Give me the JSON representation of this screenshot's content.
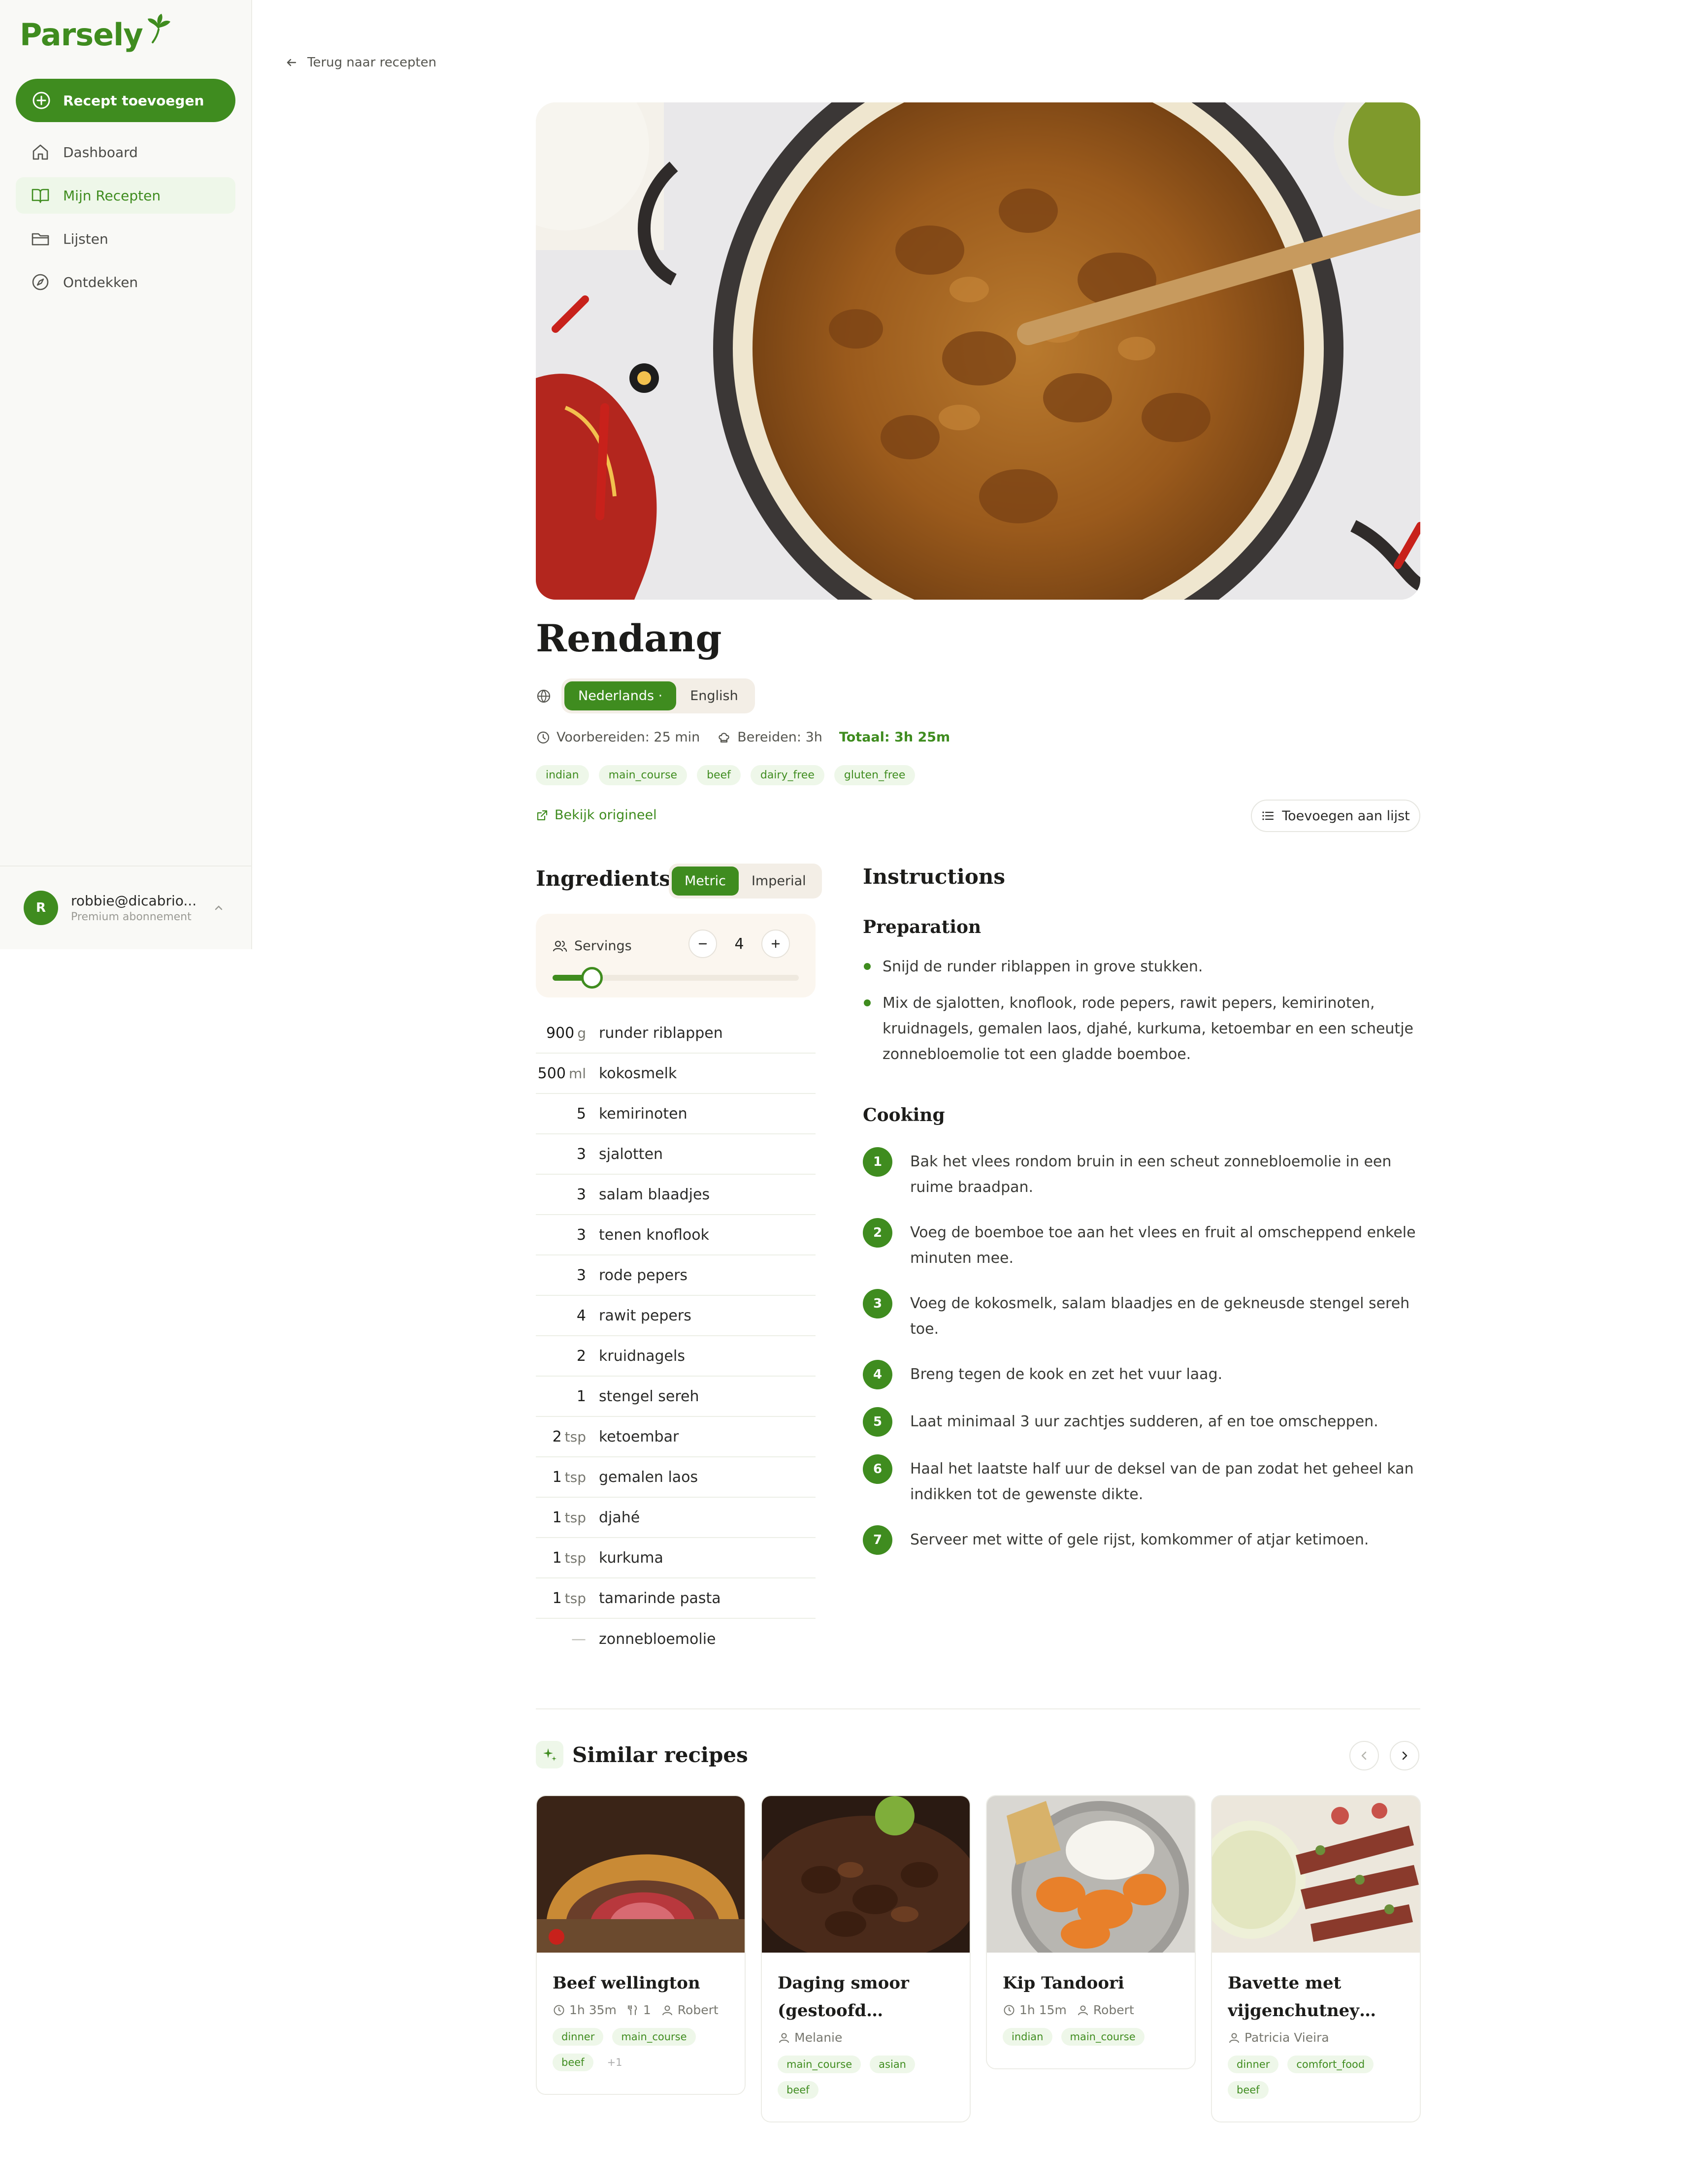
{
  "app": {
    "logo": "Parsely"
  },
  "sidebar": {
    "add_button": "Recept toevoegen",
    "items": [
      {
        "label": "Dashboard",
        "icon": "home-icon"
      },
      {
        "label": "Mijn Recepten",
        "icon": "book-icon",
        "active": true
      },
      {
        "label": "Lijsten",
        "icon": "folder-icon"
      },
      {
        "label": "Ontdekken",
        "icon": "compass-icon"
      }
    ],
    "user": {
      "initial": "R",
      "email": "robbie@dicabrio...",
      "plan": "Premium abonnement"
    }
  },
  "back_link": "Terug naar recepten",
  "recipe": {
    "title": "Rendang",
    "languages": [
      "Nederlands ·",
      "English"
    ],
    "prep": "Voorbereiden: 25 min",
    "cook": "Bereiden: 3h",
    "total": "Totaal: 3h 25m",
    "tags": [
      "indian",
      "main_course",
      "beef",
      "dairy_free",
      "gluten_free"
    ],
    "original_link": "Bekijk origineel",
    "add_to_list": "Toevoegen aan lijst"
  },
  "ingredients": {
    "heading": "Ingredients",
    "units": [
      "Metric",
      "Imperial"
    ],
    "servings_label": "Servings",
    "servings": "4",
    "servings_fraction": 0.12,
    "items": [
      {
        "qty": "900",
        "unit": "g",
        "name": "runder riblappen"
      },
      {
        "qty": "500",
        "unit": "ml",
        "name": "kokosmelk"
      },
      {
        "qty": "5",
        "unit": "",
        "name": "kemirinoten"
      },
      {
        "qty": "3",
        "unit": "",
        "name": "sjalotten"
      },
      {
        "qty": "3",
        "unit": "",
        "name": "salam blaadjes"
      },
      {
        "qty": "3",
        "unit": "",
        "name": "tenen knoflook"
      },
      {
        "qty": "3",
        "unit": "",
        "name": "rode pepers"
      },
      {
        "qty": "4",
        "unit": "",
        "name": "rawit pepers"
      },
      {
        "qty": "2",
        "unit": "",
        "name": "kruidnagels"
      },
      {
        "qty": "1",
        "unit": "",
        "name": "stengel sereh"
      },
      {
        "qty": "2",
        "unit": "tsp",
        "name": "ketoembar"
      },
      {
        "qty": "1",
        "unit": "tsp",
        "name": "gemalen laos"
      },
      {
        "qty": "1",
        "unit": "tsp",
        "name": "djahé"
      },
      {
        "qty": "1",
        "unit": "tsp",
        "name": "kurkuma"
      },
      {
        "qty": "1",
        "unit": "tsp",
        "name": "tamarinde pasta"
      },
      {
        "qty": "—",
        "unit": "",
        "name": "zonnebloemolie"
      }
    ]
  },
  "instructions": {
    "heading": "Instructions",
    "preparation_heading": "Preparation",
    "preparation": [
      "Snijd de runder riblappen in grove stukken.",
      "Mix de sjalotten, knoflook, rode pepers, rawit pepers, kemirinoten, kruidnagels, gemalen laos, djahé, kurkuma, ketoembar en een scheutje zonnebloemolie tot een gladde boemboe."
    ],
    "cooking_heading": "Cooking",
    "cooking": [
      "Bak het vlees rondom bruin in een scheut zonnebloemolie in een ruime braadpan.",
      "Voeg de boemboe toe aan het vlees en fruit al omscheppend enkele minuten mee.",
      "Voeg de kokosmelk, salam blaadjes en de gekneusde stengel sereh toe.",
      "Breng tegen de kook en zet het vuur laag.",
      "Laat minimaal 3 uur zachtjes sudderen, af en toe omscheppen.",
      "Haal het laatste half uur de deksel van de pan zodat het geheel kan indikken tot de gewenste dikte.",
      "Serveer met witte of gele rijst, komkommer of atjar ketimoen."
    ]
  },
  "similar": {
    "heading": "Similar recipes",
    "cards": [
      {
        "title": "Beef wellington",
        "time": "1h 35m",
        "servings": "1",
        "author": "Robert",
        "tags": [
          "dinner",
          "main_course",
          "beef"
        ],
        "more": "+1"
      },
      {
        "title": "Daging smoor (gestoofd rundvle...",
        "author": "Melanie",
        "tags": [
          "main_course",
          "asian",
          "beef"
        ]
      },
      {
        "title": "Kip Tandoori",
        "time": "1h 15m",
        "author": "Robert",
        "tags": [
          "indian",
          "main_course"
        ]
      },
      {
        "title": "Bavette met vijgenchutney en...",
        "author": "Patricia Vieira",
        "tags": [
          "dinner",
          "comfort_food",
          "beef"
        ]
      }
    ]
  },
  "colors": {
    "accent": "#3f8c1f",
    "accent_light": "#eef7e9",
    "sidebar_bg": "#f9f9f6"
  }
}
